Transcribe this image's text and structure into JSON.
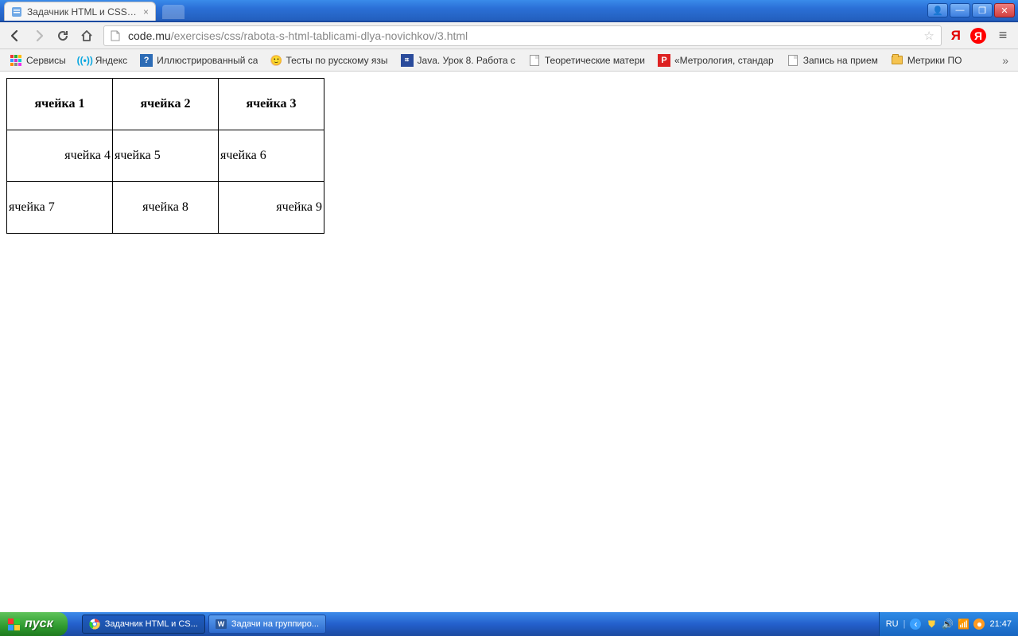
{
  "window": {
    "tab_title": "Задачник HTML и CSS от Тр",
    "win_buttons": {
      "user": "👤",
      "min": "—",
      "max": "❐",
      "close": "✕"
    }
  },
  "toolbar": {
    "url_host": "code.mu",
    "url_path": "/exercises/css/rabota-s-html-tablicami-dlya-novichkov/3.html",
    "yandex_letter": "Я",
    "yandex_circle": "Я"
  },
  "bookmarks": {
    "items": [
      {
        "label": "Сервисы",
        "icon": "grid"
      },
      {
        "label": "Яндекс",
        "icon": "yandex"
      },
      {
        "label": "Иллюстрированный са",
        "icon": "q"
      },
      {
        "label": "Тесты по русскому язы",
        "icon": "face"
      },
      {
        "label": "Java. Урок 8. Работа с",
        "icon": "java"
      },
      {
        "label": "Теоретические матери",
        "icon": "doc"
      },
      {
        "label": "«Метрология, стандар",
        "icon": "p"
      },
      {
        "label": "Запись на прием",
        "icon": "doc"
      },
      {
        "label": "Метрики ПО",
        "icon": "folder"
      }
    ],
    "overflow": "»"
  },
  "table": {
    "rows": [
      [
        "ячейка 1",
        "ячейка 2",
        "ячейка 3"
      ],
      [
        "ячейка 4",
        "ячейка 5",
        "ячейка 6"
      ],
      [
        "ячейка 7",
        "ячейка 8",
        "ячейка 9"
      ]
    ]
  },
  "taskbar": {
    "start": "пуск",
    "items": [
      {
        "label": "Задачник HTML и CS...",
        "icon": "chrome",
        "active": true
      },
      {
        "label": "Задачи на группиро...",
        "icon": "word",
        "active": false
      }
    ],
    "lang": "RU",
    "clock": "21:47"
  }
}
